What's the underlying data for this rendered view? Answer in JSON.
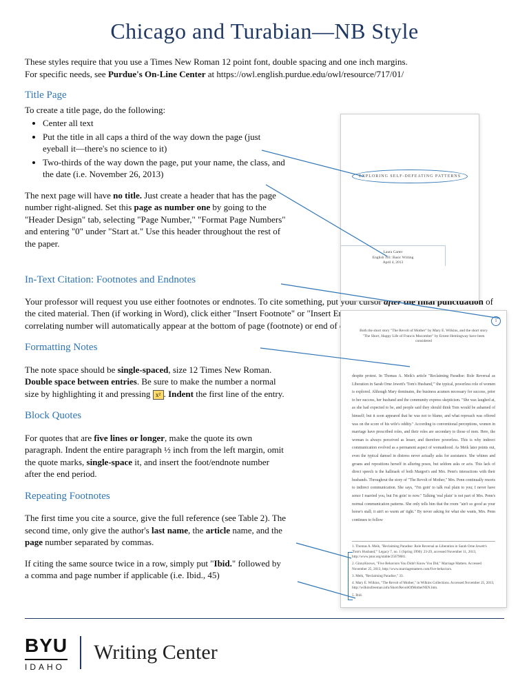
{
  "title": "Chicago and Turabian—NB Style",
  "intro_line1": "These styles require that you use a Times New Roman 12 point font, double spacing and one inch margins.",
  "intro_line2_prefix": "For specific needs, see ",
  "intro_line2_bold": "Purdue's On-Line Center",
  "intro_line2_suffix": " at https://owl.english.purdue.edu/owl/resource/717/01/",
  "sections": {
    "title_page": {
      "heading": "Title Page",
      "lead": "To create a title page, do the following:",
      "bullets": [
        "Center all text",
        "Put the title in all caps a third of the way down the page (just eyeball it—there's no science to it)",
        "Two-thirds of the way down the page, put your name, the class, and the date (i.e. November 26, 2013)"
      ],
      "para2": "The next page will have <b>no title.</b> Just create a header that has the page number right-aligned. Set this <b>page as number one</b> by going to the \"Header Design\" tab, selecting \"Page Number,\" \"Format Page Numbers\" and entering \"0\" under \"Start at.\" Use this header throughout the rest of the paper."
    },
    "intext": {
      "heading": "In-Text Citation: Footnotes and Endnotes",
      "para": "Your professor will request you use either footnotes or endnotes. To cite something, put your cursor <b><i>after</i> the final punctuation</b> of the cited material. Then (if working in Word), click either \"Insert Footnote\" or \"Insert Endnote\" under the \"References\" tab. A correlating number will automatically appear at the bottom of page (footnote) or end of document (endnote)."
    },
    "formatting": {
      "heading": "Formatting Notes",
      "para": "The note space should be <b>single-spaced</b>, size 12 Times New Roman. <b>Double space between entries</b>. Be sure to make the number a normal size by highlighting it and pressing <span class=\"key\" data-name=\"key-icon\" data-interactable=\"false\">x²</span>. <b>Indent</b> the first line of the entry."
    },
    "block": {
      "heading": "Block Quotes",
      "para": "For quotes that are <b>five lines or longer</b>, make the quote its own paragraph. Indent the entire paragraph ½ inch from the left margin, omit the quote marks, <b>single-space</b> it, and insert the foot/endnote number after the end period."
    },
    "repeat": {
      "heading": "Repeating Footnotes",
      "para1": "The first time you cite a source, give the full reference (see Table 2). The second time, only give the author's <b>last name</b>, the <b>article</b> name, and the <b>page</b> number separated by commas.",
      "para2": "If citing the same source twice in a row, simply put \"<b>Ibid.</b>\" followed by a comma and page number if applicable (i.e. Ibid., 45)"
    }
  },
  "sample1": {
    "title": "EXPLORING SELF-DEFEATING PATTERNS",
    "name": "Laura Carter",
    "class": "English 101: Basic Writing",
    "date": "April 4, 2013"
  },
  "sample2": {
    "pagenum": "1",
    "header1": "Both the short story \"The Revolt of Mother\" by Mary E. Wilkins, and the short story",
    "header2": "\"The Short, Happy Life of Francis Macomber\" by Ernest Hemingway have been considered",
    "body": "despite protest. In Thomas A. Meik's article \"Reclaiming Paradise: Role Reversal as Liberation in Sarah Orne Jewett's 'Tom's Husband,'\" the typical, powerless role of women is explored. Although Mary dominates, the business acumen necessary for success, prior to her success, her husband and the community express skepticism. \"She was laughed at, as she had expected to be, and people said they should think Tom would be ashamed of himself; but it soon appeared that he was not to blame, and what reproach was offered was on the score of his wife's oddity.\" According to conventional perceptions, women in marriage have prescribed roles, and their roles are secondary to those of men. Here, the woman is always perceived as lesser, and therefore powerless. This is why indirect communication evolved as a permanent aspect of womanhood. As Meik later points out, even the typical damsel in distress never actually asks for assistance. She whines and groans and repositions herself in alluring poses, but seldom asks or acts. This lack of direct speech is the hallmark of both Margret's and Mrs. Penn's interactions with their husbands. Throughout the story of \"The Revolt of Mother,\" Mrs. Penn continually resorts to indirect communication. She says, \"I'm goin' to talk real plain to you; I never have sence I married you, but I'm goin' to now.\" Talking 'real plain' is not part of Mrs. Penn's normal communication patterns. She only tells him that the room \"ain't so good as your horse's stall; it ain't so warm an' tight.\" By never asking for what she wants, Mrs. Penn continues to follow",
    "footnotes": [
      "1. Thomas A. Meik, \"Reclaiming Paradise: Role Reversal as Liberation in Sarah Orne Jewett's 'Tom's Husband,'\" Legacy 7, no. 1 (Spring 1990): 23-29, accessed November 11, 2013, http://www.jstor.org/stable/25679081.",
      "2. GinnyKnows, \"Five Behaviors You Didn't Know You Did,\" Marriage Matters. Accessed November 25, 2013, http://www.marriagematters.com/five-behaviors.",
      "3. Meik, \"Reclaiming Paradise,\" 33.",
      "4. Mary E. Wilkins, \"The Revolt of Mother,\" in Wilkins Collections. Accessed November 25, 2013, http://wilkinsfreeman.info/Short/RevoltOfMotherNEN.htm.",
      "5. Ibid."
    ]
  },
  "footer": {
    "byu": "BYU",
    "idaho": "IDAHO",
    "wc": "Writing Center"
  }
}
